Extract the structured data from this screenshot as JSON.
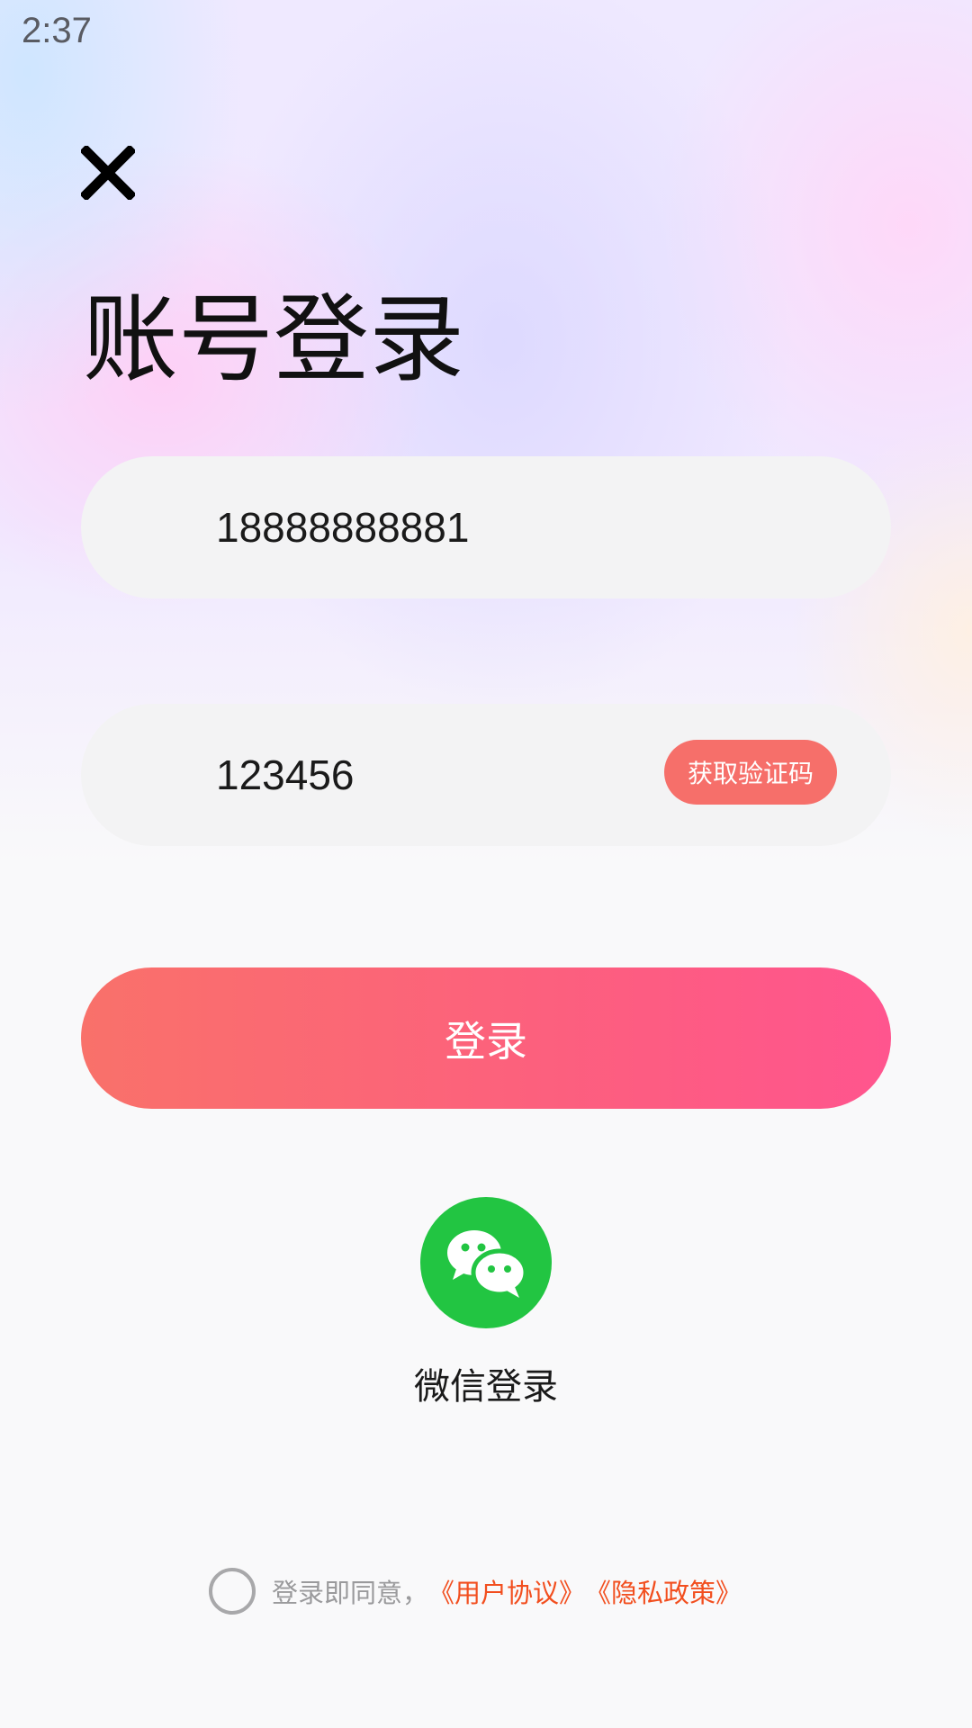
{
  "status_bar": {
    "time": "2:37"
  },
  "header": {
    "title": "账号登录"
  },
  "form": {
    "phone_value": "18888888881",
    "code_value": "123456",
    "get_code_label": "获取验证码",
    "login_label": "登录"
  },
  "wechat": {
    "label": "微信登录"
  },
  "agreement": {
    "prefix": "登录即同意，",
    "user_agreement": "《用户协议》",
    "privacy_policy": "《隐私政策》"
  },
  "colors": {
    "accent": "#f66f6a",
    "gradient_start": "#f9716a",
    "gradient_end": "#ff558e",
    "wechat_green": "#22c542",
    "link": "#f24e1e"
  },
  "icons": {
    "close": "close-icon",
    "wechat": "wechat-icon",
    "checkbox": "radio-circle"
  }
}
